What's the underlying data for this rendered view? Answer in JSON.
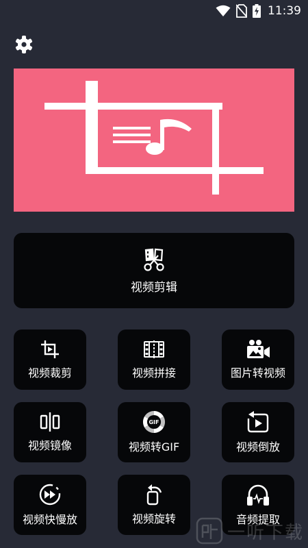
{
  "status_bar": {
    "time": "11:39"
  },
  "main_card": {
    "label": "视频剪辑",
    "icon": "film-scissors-icon"
  },
  "tiles": [
    {
      "label": "视频裁剪",
      "icon": "crop-icon"
    },
    {
      "label": "视频拼接",
      "icon": "film-join-icon"
    },
    {
      "label": "图片转视频",
      "icon": "camera-images-icon"
    },
    {
      "label": "视频镜像",
      "icon": "mirror-icon"
    },
    {
      "label": "视频转GIF",
      "icon": "gif-icon",
      "icon_text": "GIF"
    },
    {
      "label": "视频倒放",
      "icon": "reverse-play-icon"
    },
    {
      "label": "视频快慢放",
      "icon": "speed-icon"
    },
    {
      "label": "视频旋转",
      "icon": "rotate-icon"
    },
    {
      "label": "音频提取",
      "icon": "audio-extract-icon"
    }
  ],
  "watermark": {
    "text": "一听下载"
  },
  "colors": {
    "background": "#272a36",
    "banner": "#f36580",
    "card": "#060709"
  }
}
